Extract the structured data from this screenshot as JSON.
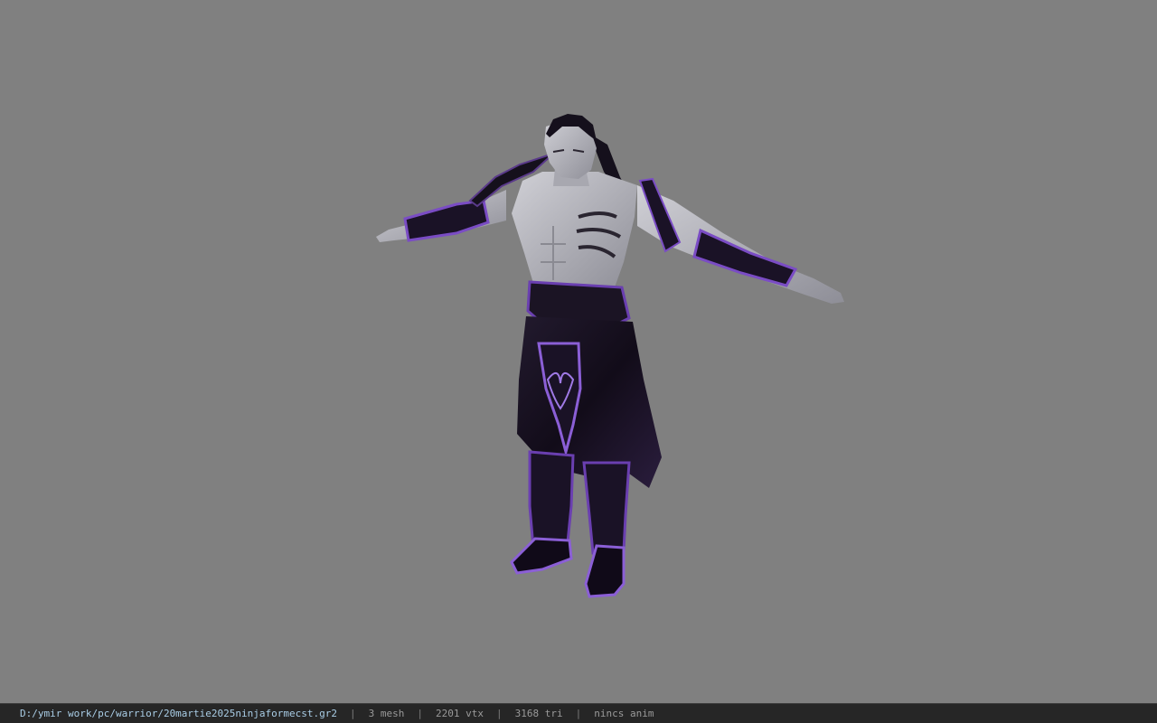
{
  "status_bar": {
    "file_path": "D:/ymir work/pc/warrior/20martie2025ninjaformecst.gr2",
    "separator": "|",
    "mesh_count": "3 mesh",
    "vertex_count": "2201 vtx",
    "triangle_count": "3168 tri",
    "anim_status": "nincs anim"
  },
  "colors": {
    "background": "#808080",
    "skin": "#b9b9c0",
    "cloth_dark": "#15101c",
    "cloth_accent": "#6a3fb0",
    "status_bg": "#262626",
    "path_text": "#a9cde6"
  }
}
